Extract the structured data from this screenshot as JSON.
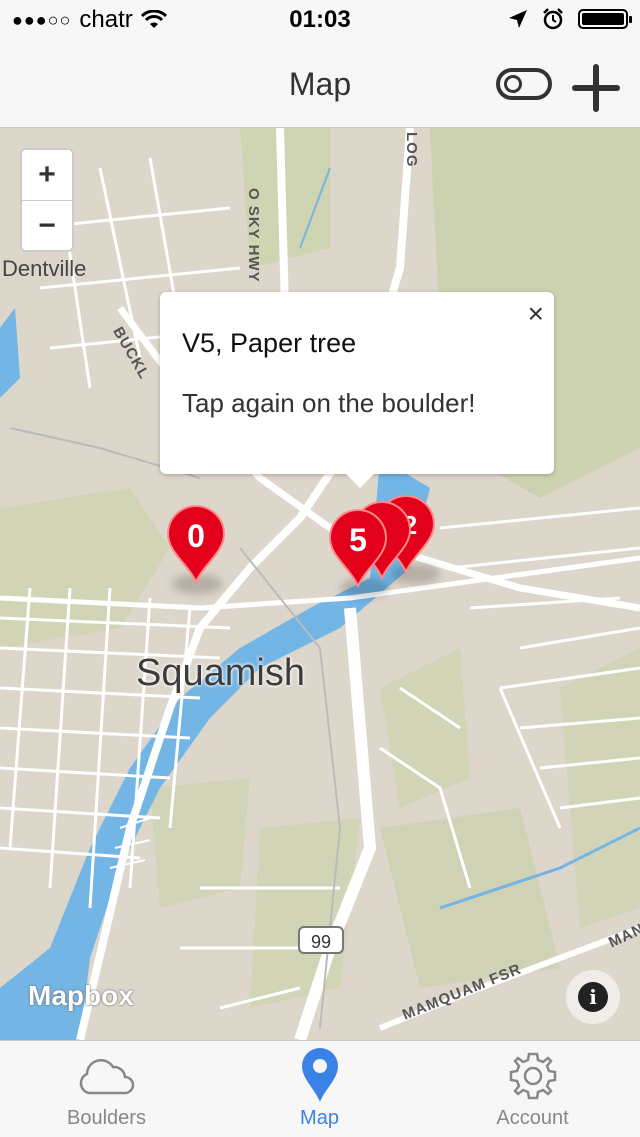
{
  "status_bar": {
    "signal": "●●●○○",
    "carrier": "chatr",
    "time": "01:03"
  },
  "nav": {
    "title": "Map",
    "toggle_icon": "toggle-icon",
    "add_icon": "plus-icon"
  },
  "map": {
    "zoom_in": "+",
    "zoom_out": "−",
    "places": {
      "dentville": "Dentville",
      "squamish": "Squamish"
    },
    "roads": {
      "sky_hwy": "O SKY HWY",
      "buckley": "BUCKL",
      "loggers": "LOG",
      "highway_99": "99",
      "mamquam": "MAMQUAM FSR",
      "man": "MAN"
    },
    "popup": {
      "title": "V5, Paper tree",
      "message": "Tap again on the boulder!",
      "close": "×"
    },
    "markers": [
      {
        "label": "0"
      },
      {
        "label": "2"
      },
      {
        "label": "5"
      }
    ],
    "attribution": "Mapbox",
    "info": "i",
    "colors": {
      "marker": "#e3001b",
      "water": "#73b5e5",
      "land": "#ddd6cb",
      "park": "#c9d4a8"
    }
  },
  "tabs": [
    {
      "label": "Boulders",
      "icon": "cloud-icon",
      "active": false
    },
    {
      "label": "Map",
      "icon": "map-pin-icon",
      "active": true
    },
    {
      "label": "Account",
      "icon": "gear-icon",
      "active": false
    }
  ],
  "colors": {
    "accent": "#3b82e6"
  }
}
